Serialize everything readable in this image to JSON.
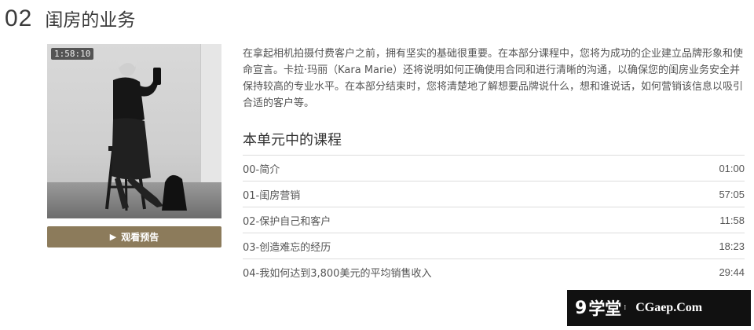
{
  "section": {
    "number": "02",
    "title": "闺房的业务"
  },
  "video": {
    "duration": "1:58:10",
    "preview_label": "观看预告"
  },
  "description": "在拿起相机拍摄付费客户之前，拥有坚实的基础很重要。在本部分课程中，您将为成功的企业建立品牌形象和使命宣言。卡拉·玛丽（Kara Marie）还将说明如何正确使用合同和进行清晰的沟通，以确保您的闺房业务安全并保持较高的专业水平。在本部分结束时，您将清楚地了解想要品牌说什么，想和谁说话，如何营销该信息以吸引合适的客户等。",
  "lessons_heading": "本单元中的课程",
  "lessons": [
    {
      "title": "00-简介",
      "time": "01:00"
    },
    {
      "title": "01-闺房营销",
      "time": "57:05"
    },
    {
      "title": "02-保护自己和客户",
      "time": "11:58"
    },
    {
      "title": "03-创造难忘的经历",
      "time": "18:23"
    },
    {
      "title": "04-我如何达到3,800美元的平均销售收入",
      "time": "29:44"
    }
  ],
  "watermark": {
    "logo": "9",
    "cn": "学堂",
    "site": "CGaep.Com"
  },
  "colors": {
    "button": "#8c7b5b",
    "divider": "#dddddd",
    "text": "#555555"
  }
}
